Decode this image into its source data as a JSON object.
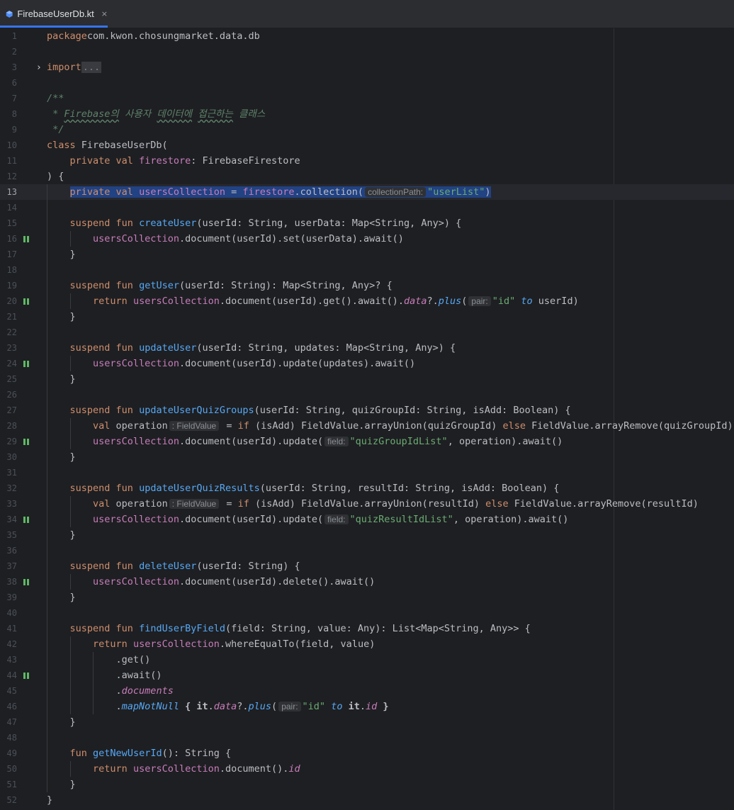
{
  "tab": {
    "file_name": "FirebaseUserDb.kt",
    "close_icon": "×"
  },
  "colors": {
    "keyword": "#cf8e6d",
    "function_decl": "#56a8f5",
    "property": "#c77dbb",
    "string": "#6aab73",
    "default_text": "#bcbec4",
    "doc_comment": "#5f826b",
    "run_marker": "#5fb865",
    "selection": "#214283"
  },
  "icons": {
    "file": "kotlin-file-icon",
    "fold": "chevron-right-icon",
    "marker": "run-marker-icon"
  },
  "editor": {
    "current_line": 13,
    "selection_line": 13,
    "lines": [
      {
        "n": 1,
        "tokens": [
          [
            "kw",
            "package"
          ],
          [
            "",
            "com.kwon.chosungmarket.data.db"
          ]
        ]
      },
      {
        "n": 2,
        "tokens": []
      },
      {
        "n": 3,
        "fold": true,
        "tokens": [
          [
            "kw",
            "import"
          ],
          [
            "",
            ""
          ],
          [
            "fold",
            "..."
          ]
        ]
      },
      {
        "n": 6,
        "tokens": []
      },
      {
        "n": 7,
        "tokens": [
          [
            "doc",
            "/**"
          ]
        ]
      },
      {
        "n": 8,
        "tokens": [
          [
            "doc",
            " * "
          ],
          [
            "docw",
            "Firebase의"
          ],
          [
            "doc",
            " 사용자 "
          ],
          [
            "docw",
            "데이터에"
          ],
          [
            "doc",
            " "
          ],
          [
            "docw",
            "접근하는"
          ],
          [
            "doc",
            " 클래스"
          ]
        ]
      },
      {
        "n": 9,
        "tokens": [
          [
            "doc",
            " */"
          ]
        ]
      },
      {
        "n": 10,
        "tokens": [
          [
            "kw",
            "class"
          ],
          [
            "",
            " FirebaseUserDb("
          ]
        ]
      },
      {
        "n": 11,
        "tokens": [
          [
            "",
            "    "
          ],
          [
            "kw",
            "private val"
          ],
          [
            "",
            " "
          ],
          [
            "prop",
            "firestore"
          ],
          [
            "",
            ": FirebaseFirestore"
          ]
        ]
      },
      {
        "n": 12,
        "tokens": [
          [
            "",
            ") {"
          ]
        ]
      },
      {
        "n": 13,
        "tokens": [
          [
            "",
            "    "
          ],
          [
            "selstart",
            ""
          ],
          [
            "kw",
            "private val"
          ],
          [
            "",
            " "
          ],
          [
            "prop",
            "usersCollection"
          ],
          [
            "",
            " = "
          ],
          [
            "prop",
            "firestore"
          ],
          [
            "",
            ".collection("
          ],
          [
            "hint",
            "collectionPath:"
          ],
          [
            "str",
            "\"userList\""
          ],
          [
            "",
            ")"
          ],
          [
            "selend",
            ""
          ]
        ]
      },
      {
        "n": 14,
        "tokens": []
      },
      {
        "n": 15,
        "tokens": [
          [
            "",
            "    "
          ],
          [
            "kw",
            "suspend fun"
          ],
          [
            "",
            " "
          ],
          [
            "fnd",
            "createUser"
          ],
          [
            "",
            "(userId: String, userData: Map<String, Any>) {"
          ]
        ]
      },
      {
        "n": 16,
        "marker": true,
        "tokens": [
          [
            "",
            "        "
          ],
          [
            "prop",
            "usersCollection"
          ],
          [
            "",
            ".document(userId).set(userData).await()"
          ]
        ]
      },
      {
        "n": 17,
        "tokens": [
          [
            "",
            "    }"
          ]
        ]
      },
      {
        "n": 18,
        "tokens": []
      },
      {
        "n": 19,
        "tokens": [
          [
            "",
            "    "
          ],
          [
            "kw",
            "suspend fun"
          ],
          [
            "",
            " "
          ],
          [
            "fnd",
            "getUser"
          ],
          [
            "",
            "(userId: String): Map<String, Any>? {"
          ]
        ]
      },
      {
        "n": 20,
        "marker": true,
        "tokens": [
          [
            "",
            "        "
          ],
          [
            "kw",
            "return"
          ],
          [
            "",
            " "
          ],
          [
            "prop",
            "usersCollection"
          ],
          [
            "",
            ".document(userId).get().await()."
          ],
          [
            "propi",
            "data"
          ],
          [
            "",
            "?."
          ],
          [
            "ext",
            "plus"
          ],
          [
            "",
            "("
          ],
          [
            "hint",
            "pair:"
          ],
          [
            "str",
            "\"id\""
          ],
          [
            "",
            " "
          ],
          [
            "ext",
            "to"
          ],
          [
            "",
            " userId)"
          ]
        ]
      },
      {
        "n": 21,
        "tokens": [
          [
            "",
            "    }"
          ]
        ]
      },
      {
        "n": 22,
        "tokens": []
      },
      {
        "n": 23,
        "tokens": [
          [
            "",
            "    "
          ],
          [
            "kw",
            "suspend fun"
          ],
          [
            "",
            " "
          ],
          [
            "fnd",
            "updateUser"
          ],
          [
            "",
            "(userId: String, updates: Map<String, Any>) {"
          ]
        ]
      },
      {
        "n": 24,
        "marker": true,
        "tokens": [
          [
            "",
            "        "
          ],
          [
            "prop",
            "usersCollection"
          ],
          [
            "",
            ".document(userId).update(updates).await()"
          ]
        ]
      },
      {
        "n": 25,
        "tokens": [
          [
            "",
            "    }"
          ]
        ]
      },
      {
        "n": 26,
        "tokens": []
      },
      {
        "n": 27,
        "tokens": [
          [
            "",
            "    "
          ],
          [
            "kw",
            "suspend fun"
          ],
          [
            "",
            " "
          ],
          [
            "fnd",
            "updateUserQuizGroups"
          ],
          [
            "",
            "(userId: String, quizGroupId: String, isAdd: Boolean) {"
          ]
        ]
      },
      {
        "n": 28,
        "tokens": [
          [
            "",
            "        "
          ],
          [
            "kw",
            "val"
          ],
          [
            "",
            " operation"
          ],
          [
            "hint",
            ": FieldValue"
          ],
          [
            "",
            " = "
          ],
          [
            "kw",
            "if"
          ],
          [
            "",
            " (isAdd) FieldValue.arrayUnion(quizGroupId) "
          ],
          [
            "kw",
            "else"
          ],
          [
            "",
            " FieldValue.arrayRemove(quizGroupId)"
          ]
        ]
      },
      {
        "n": 29,
        "marker": true,
        "tokens": [
          [
            "",
            "        "
          ],
          [
            "prop",
            "usersCollection"
          ],
          [
            "",
            ".document(userId).update("
          ],
          [
            "hint",
            "field:"
          ],
          [
            "str",
            "\"quizGroupIdList\""
          ],
          [
            "",
            ", operation).await()"
          ]
        ]
      },
      {
        "n": 30,
        "tokens": [
          [
            "",
            "    }"
          ]
        ]
      },
      {
        "n": 31,
        "tokens": []
      },
      {
        "n": 32,
        "tokens": [
          [
            "",
            "    "
          ],
          [
            "kw",
            "suspend fun"
          ],
          [
            "",
            " "
          ],
          [
            "fnd",
            "updateUserQuizResults"
          ],
          [
            "",
            "(userId: String, resultId: String, isAdd: Boolean) {"
          ]
        ]
      },
      {
        "n": 33,
        "tokens": [
          [
            "",
            "        "
          ],
          [
            "kw",
            "val"
          ],
          [
            "",
            " operation"
          ],
          [
            "hint",
            ": FieldValue"
          ],
          [
            "",
            " = "
          ],
          [
            "kw",
            "if"
          ],
          [
            "",
            " (isAdd) FieldValue.arrayUnion(resultId) "
          ],
          [
            "kw",
            "else"
          ],
          [
            "",
            " FieldValue.arrayRemove(resultId)"
          ]
        ]
      },
      {
        "n": 34,
        "marker": true,
        "tokens": [
          [
            "",
            "        "
          ],
          [
            "prop",
            "usersCollection"
          ],
          [
            "",
            ".document(userId).update("
          ],
          [
            "hint",
            "field:"
          ],
          [
            "str",
            "\"quizResultIdList\""
          ],
          [
            "",
            ", operation).await()"
          ]
        ]
      },
      {
        "n": 35,
        "tokens": [
          [
            "",
            "    }"
          ]
        ]
      },
      {
        "n": 36,
        "tokens": []
      },
      {
        "n": 37,
        "tokens": [
          [
            "",
            "    "
          ],
          [
            "kw",
            "suspend fun"
          ],
          [
            "",
            " "
          ],
          [
            "fnd",
            "deleteUser"
          ],
          [
            "",
            "(userId: String) {"
          ]
        ]
      },
      {
        "n": 38,
        "marker": true,
        "tokens": [
          [
            "",
            "        "
          ],
          [
            "prop",
            "usersCollection"
          ],
          [
            "",
            ".document(userId).delete().await()"
          ]
        ]
      },
      {
        "n": 39,
        "tokens": [
          [
            "",
            "    }"
          ]
        ]
      },
      {
        "n": 40,
        "tokens": []
      },
      {
        "n": 41,
        "tokens": [
          [
            "",
            "    "
          ],
          [
            "kw",
            "suspend fun"
          ],
          [
            "",
            " "
          ],
          [
            "fnd",
            "findUserByField"
          ],
          [
            "",
            "(field: String, value: Any): List<Map<String, Any>> {"
          ]
        ]
      },
      {
        "n": 42,
        "tokens": [
          [
            "",
            "        "
          ],
          [
            "kw",
            "return"
          ],
          [
            "",
            " "
          ],
          [
            "prop",
            "usersCollection"
          ],
          [
            "",
            ".whereEqualTo(field, value)"
          ]
        ]
      },
      {
        "n": 43,
        "tokens": [
          [
            "",
            "            .get()"
          ]
        ]
      },
      {
        "n": 44,
        "marker": true,
        "tokens": [
          [
            "",
            "            .await()"
          ]
        ]
      },
      {
        "n": 45,
        "tokens": [
          [
            "",
            "            ."
          ],
          [
            "propi",
            "documents"
          ]
        ]
      },
      {
        "n": 46,
        "tokens": [
          [
            "",
            "            ."
          ],
          [
            "ext",
            "mapNotNull"
          ],
          [
            "",
            " "
          ],
          [
            "bold",
            "{ it"
          ],
          [
            "",
            "."
          ],
          [
            "propi",
            "data"
          ],
          [
            "",
            "?."
          ],
          [
            "ext",
            "plus"
          ],
          [
            "",
            "("
          ],
          [
            "hint",
            "pair:"
          ],
          [
            "str",
            "\"id\""
          ],
          [
            "",
            " "
          ],
          [
            "ext",
            "to"
          ],
          [
            "",
            " "
          ],
          [
            "bold",
            "it"
          ],
          [
            "",
            "."
          ],
          [
            "propi",
            "id"
          ],
          [
            "",
            " "
          ],
          [
            "bold",
            "}"
          ]
        ]
      },
      {
        "n": 47,
        "tokens": [
          [
            "",
            "    }"
          ]
        ]
      },
      {
        "n": 48,
        "tokens": []
      },
      {
        "n": 49,
        "tokens": [
          [
            "",
            "    "
          ],
          [
            "kw",
            "fun"
          ],
          [
            "",
            " "
          ],
          [
            "fnd",
            "getNewUserId"
          ],
          [
            "",
            "(): String {"
          ]
        ]
      },
      {
        "n": 50,
        "tokens": [
          [
            "",
            "        "
          ],
          [
            "kw",
            "return"
          ],
          [
            "",
            " "
          ],
          [
            "prop",
            "usersCollection"
          ],
          [
            "",
            ".document()."
          ],
          [
            "propi",
            "id"
          ]
        ]
      },
      {
        "n": 51,
        "tokens": [
          [
            "",
            "    }"
          ]
        ]
      },
      {
        "n": 52,
        "tokens": [
          [
            "",
            "}"
          ]
        ]
      }
    ]
  }
}
